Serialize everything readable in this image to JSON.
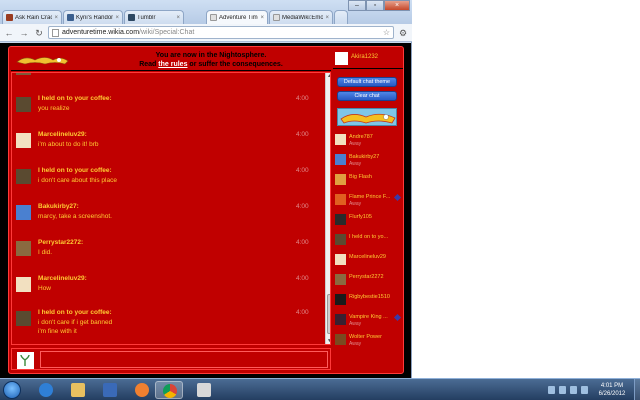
{
  "browser": {
    "tabs": [
      {
        "label": "Ask Rain Crack",
        "active": false
      },
      {
        "label": "Kyni's Random",
        "active": false
      },
      {
        "label": "Tumblr",
        "active": false
      },
      {
        "label": "Adventure Time",
        "active": true
      },
      {
        "label": "MediaWiki:Emo",
        "active": false
      }
    ],
    "url_host": "adventuretime.wikia.com",
    "url_path": "/wiki/Special:Chat"
  },
  "chat": {
    "announcement_line1": "You are now in the Nightosphere.",
    "announcement_pre": "Read ",
    "announcement_link": "the rules",
    "announcement_post": " or suffer the consequences.",
    "truncated_top_text": "...",
    "messages": [
      {
        "nick": "I held on to your coffee:",
        "lines": [
          "you realize"
        ],
        "time": "4:00"
      },
      {
        "nick": "Marcelineluv29:",
        "lines": [
          "i'm about to do it! brb"
        ],
        "time": "4:00"
      },
      {
        "nick": "I held on to your coffee:",
        "lines": [
          "i don't care about this place"
        ],
        "time": "4:00"
      },
      {
        "nick": "Bakukirby27:",
        "lines": [
          "marcy, take a screenshot."
        ],
        "time": "4:00"
      },
      {
        "nick": "Perrystar2272:",
        "lines": [
          "I did."
        ],
        "time": "4:00"
      },
      {
        "nick": "Marcelineluv29:",
        "lines": [
          "How"
        ],
        "time": "4:00"
      },
      {
        "nick": "I held on to your coffee:",
        "lines": [
          "i don't care if i get banned",
          "i'm fine with it"
        ],
        "time": "4:00"
      }
    ],
    "input_value": ""
  },
  "rail": {
    "me": "Akira1232",
    "buttons": {
      "theme": "Default chat theme",
      "clear": "Clear chat"
    },
    "users": [
      {
        "name": "Andre787",
        "status": "Away",
        "mod": false
      },
      {
        "name": "Bakukirby27",
        "status": "Away",
        "mod": false
      },
      {
        "name": "Big Flash",
        "status": "",
        "mod": false
      },
      {
        "name": "Flame Prince F...",
        "status": "Away",
        "mod": true
      },
      {
        "name": "Flurfy105",
        "status": "",
        "mod": false
      },
      {
        "name": "I held on to yo...",
        "status": "",
        "mod": false
      },
      {
        "name": "Marcelineluv29",
        "status": "",
        "mod": false
      },
      {
        "name": "Perrystar2272",
        "status": "",
        "mod": false
      },
      {
        "name": "Rigbybestie1510",
        "status": "",
        "mod": false
      },
      {
        "name": "Vampire King ...",
        "status": "Away",
        "mod": true
      },
      {
        "name": "Wolter Power",
        "status": "Away",
        "mod": false
      }
    ]
  },
  "taskbar": {
    "time": "4:01 PM",
    "date": "6/26/2012"
  },
  "colors": {
    "chat_bg": "#c00000",
    "nick": "#ffcc33",
    "button": "#2859c4"
  }
}
